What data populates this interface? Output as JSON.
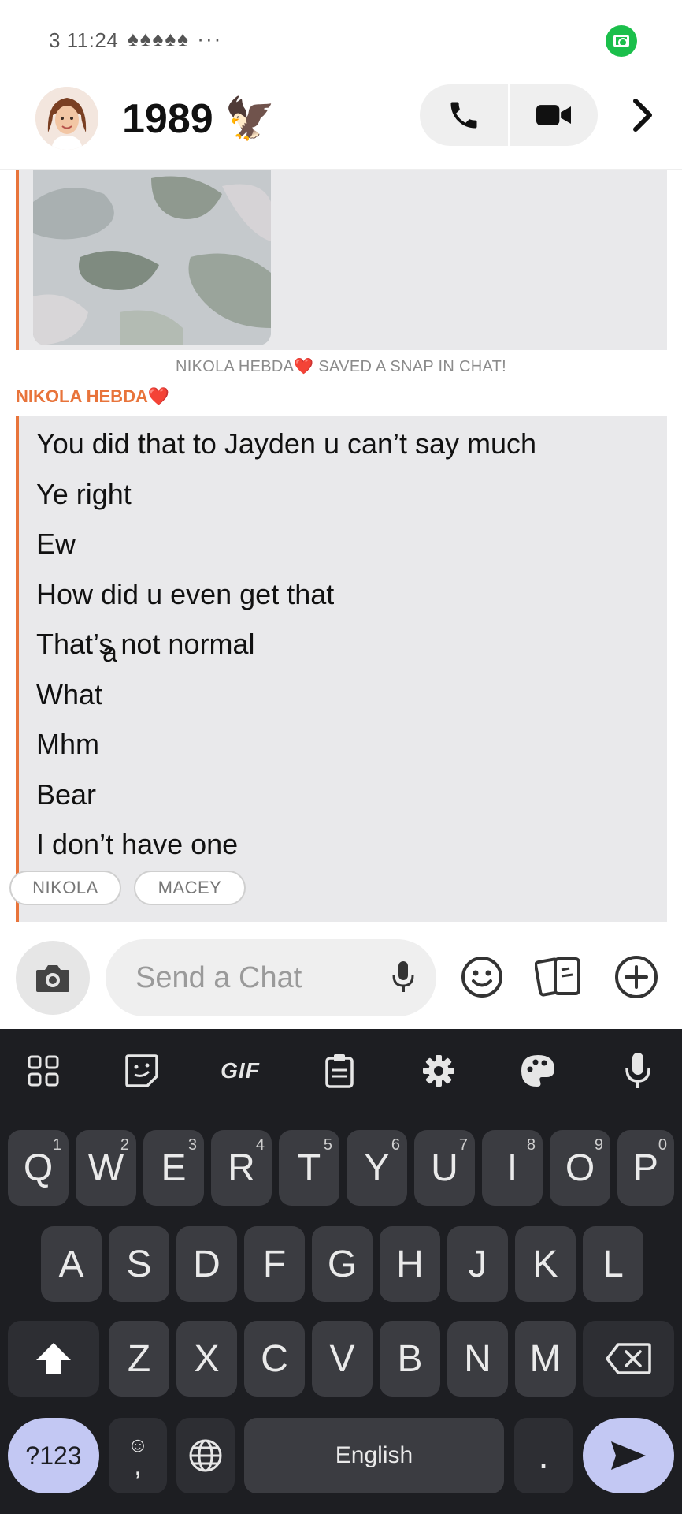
{
  "status_bar": {
    "time": "3 11:24",
    "notification_icons": "♠♠♠♠♠ ···"
  },
  "header": {
    "name": "1989",
    "emoji": "🦅"
  },
  "chat": {
    "system_message": "NIKOLA HEBDA❤️ SAVED A SNAP IN CHAT!",
    "sender": "NIKOLA HEBDA❤️",
    "messages": [
      "You did that to Jayden u can’t say much",
      "Ye right",
      "Ew",
      "How did u even get that",
      "That’s not normal",
      "What",
      "Mhm",
      "Bear",
      "I don’t have one"
    ],
    "partial_char": "a",
    "chips": [
      "NIKOLA",
      "MACEY"
    ]
  },
  "input": {
    "placeholder": "Send a Chat"
  },
  "keyboard": {
    "toolbar": [
      "apps",
      "sticker",
      "GIF",
      "clipboard",
      "settings",
      "theme",
      "voice"
    ],
    "row1": [
      {
        "k": "Q",
        "s": "1"
      },
      {
        "k": "W",
        "s": "2"
      },
      {
        "k": "E",
        "s": "3"
      },
      {
        "k": "R",
        "s": "4"
      },
      {
        "k": "T",
        "s": "5"
      },
      {
        "k": "Y",
        "s": "6"
      },
      {
        "k": "U",
        "s": "7"
      },
      {
        "k": "I",
        "s": "8"
      },
      {
        "k": "O",
        "s": "9"
      },
      {
        "k": "P",
        "s": "0"
      }
    ],
    "row2": [
      "A",
      "S",
      "D",
      "F",
      "G",
      "H",
      "J",
      "K",
      "L"
    ],
    "row3": [
      "Z",
      "X",
      "C",
      "V",
      "B",
      "N",
      "M"
    ],
    "numbers_key": "?123",
    "comma": ",",
    "space_label": "English",
    "period": "."
  },
  "colors": {
    "accent": "#e8743b",
    "record": "#1bbf4b",
    "keyboard_bg": "#1d1e22",
    "key_bg": "#3b3c41",
    "action_key": "#c3c8f3"
  }
}
